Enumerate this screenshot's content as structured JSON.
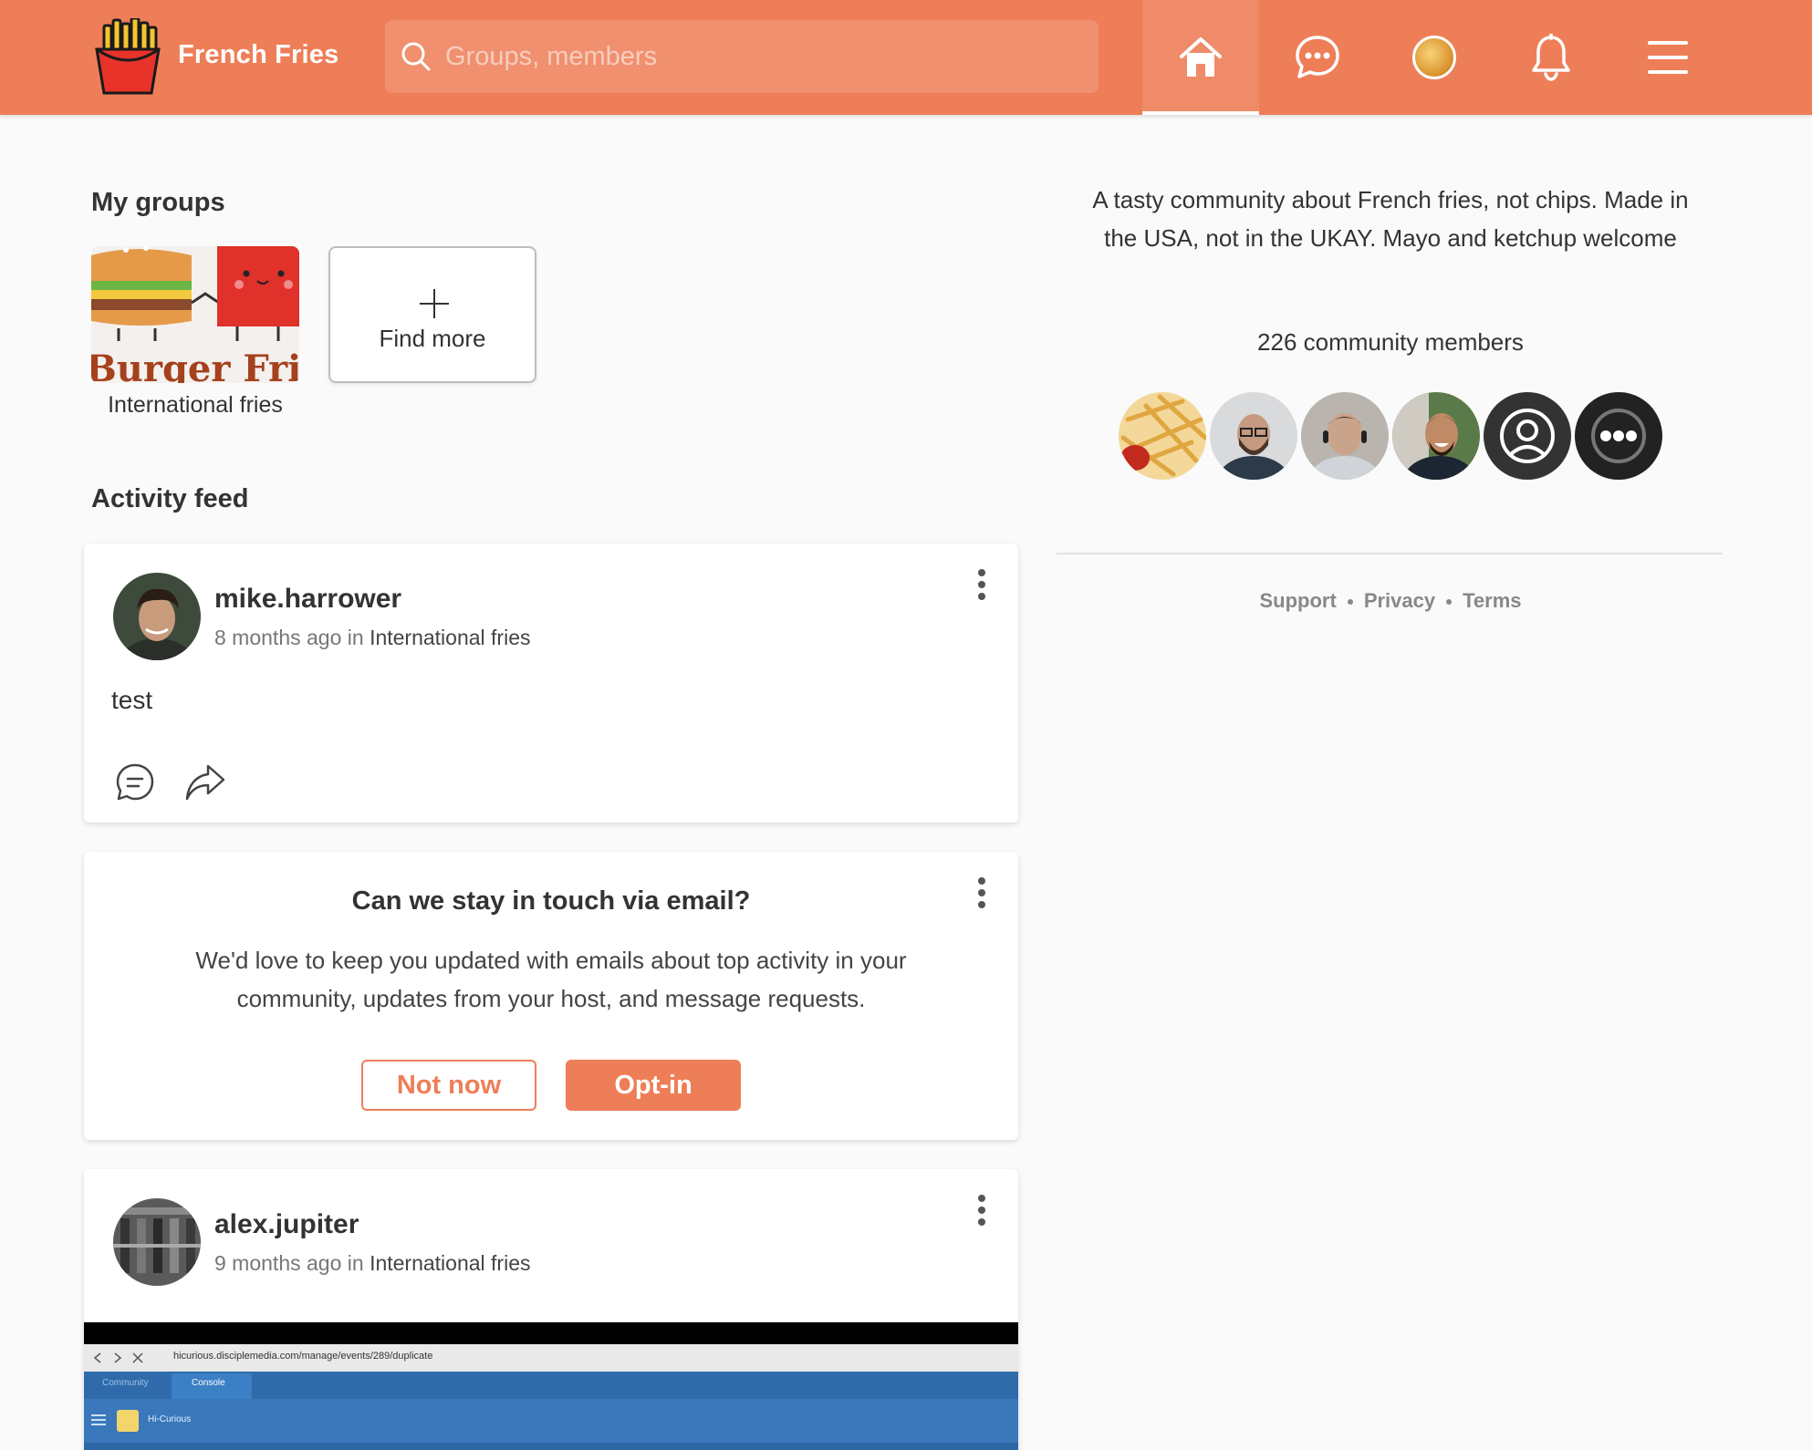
{
  "header": {
    "brand": "French Fries",
    "search_placeholder": "Groups, members",
    "nav": [
      "home-icon",
      "chat-icon",
      "profile-avatar",
      "bell-icon",
      "menu-icon"
    ],
    "accent_color": "#ee7e58"
  },
  "my_groups": {
    "title": "My groups",
    "groups": [
      {
        "label": "International fries",
        "banner_text": "Burger Fries"
      }
    ],
    "find_more_label": "Find more"
  },
  "activity": {
    "title": "Activity feed",
    "posts": [
      {
        "author": "mike.harrower",
        "time": "8 months ago",
        "in_label": "in",
        "group": "International fries",
        "body": "test"
      },
      {
        "author": "alex.jupiter",
        "time": "9 months ago",
        "in_label": "in",
        "group": "International fries",
        "screenshot": {
          "url": "hicurious.disciplemedia.com/manage/events/289/duplicate",
          "tab_community": "Community",
          "tab_console": "Console",
          "app_name": "Hi-Curious"
        }
      }
    ],
    "email_prompt": {
      "title": "Can we stay in touch via email?",
      "text": "We'd love to keep you updated with emails about top activity in your community, updates from your host, and message requests.",
      "not_now_label": "Not now",
      "opt_in_label": "Opt-in"
    }
  },
  "sidebar": {
    "about": "A tasty community about French fries, not chips. Made in the USA, not in the UKAY. Mayo and ketchup welcome",
    "member_count": "226 community members",
    "footer_links": [
      "Support",
      "Privacy",
      "Terms"
    ]
  }
}
